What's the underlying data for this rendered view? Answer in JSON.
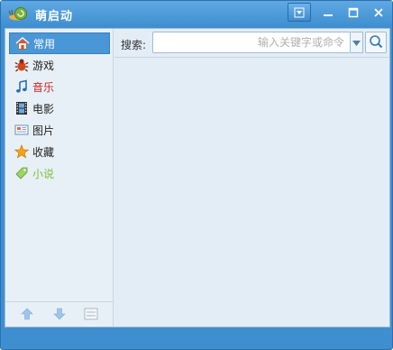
{
  "window": {
    "title": "萌启动",
    "icon": "snail-icon",
    "buttons": [
      "menu-icon",
      "minimize-icon",
      "maximize-icon",
      "close-icon"
    ]
  },
  "sidebar": {
    "items": [
      {
        "label": "常用",
        "icon": "home-icon",
        "color": "#ffffff",
        "selected": true
      },
      {
        "label": "游戏",
        "icon": "bug-icon",
        "color": "#222222",
        "selected": false
      },
      {
        "label": "音乐",
        "icon": "music-note-icon",
        "color": "#cc1f1f",
        "selected": false
      },
      {
        "label": "电影",
        "icon": "film-icon",
        "color": "#222222",
        "selected": false
      },
      {
        "label": "图片",
        "icon": "picture-icon",
        "color": "#222222",
        "selected": false
      },
      {
        "label": "收藏",
        "icon": "star-icon",
        "color": "#222222",
        "selected": false
      },
      {
        "label": "小说",
        "icon": "tag-icon",
        "color": "#7cbf3a",
        "selected": false
      }
    ],
    "footer": [
      "arrow-up-icon",
      "arrow-down-icon",
      "list-icon"
    ]
  },
  "search": {
    "label": "搜索:",
    "value": "",
    "placeholder": "输入关键字或命令"
  },
  "colors": {
    "accent": "#3f8fd0",
    "selected": "#4a97d8",
    "panel": "#e3edf5"
  }
}
